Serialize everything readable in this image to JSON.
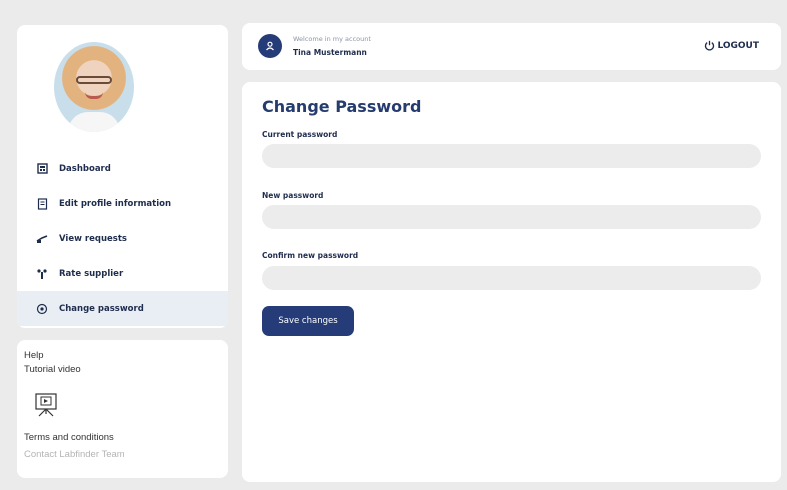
{
  "sidebar": {
    "items": [
      {
        "label": "Dashboard",
        "icon": "dashboard-icon"
      },
      {
        "label": "Edit profile information",
        "icon": "edit-profile-icon"
      },
      {
        "label": "View requests",
        "icon": "requests-icon"
      },
      {
        "label": "Rate supplier",
        "icon": "rate-icon"
      },
      {
        "label": "Change password",
        "icon": "password-icon",
        "active": true
      }
    ]
  },
  "help": {
    "title": "Help",
    "tutorial_label": "Tutorial video",
    "video_icon": "presentation-video-icon",
    "terms_label": "Terms and conditions",
    "contact_label": "Contact Labfinder Team"
  },
  "header": {
    "welcome": "Welcome in my account",
    "user_name": "Tina Mustermann",
    "logout_label": "LOGOUT"
  },
  "form": {
    "title": "Change Password",
    "current_label": "Current password",
    "current_value": "",
    "new_label": "New password",
    "new_value": "",
    "confirm_label": "Confirm new password",
    "confirm_value": "",
    "save_label": "Save changes"
  },
  "colors": {
    "primary": "#263c78",
    "background": "#ebebeb",
    "active_nav": "#e9eef5",
    "input_bg": "#ececec"
  }
}
